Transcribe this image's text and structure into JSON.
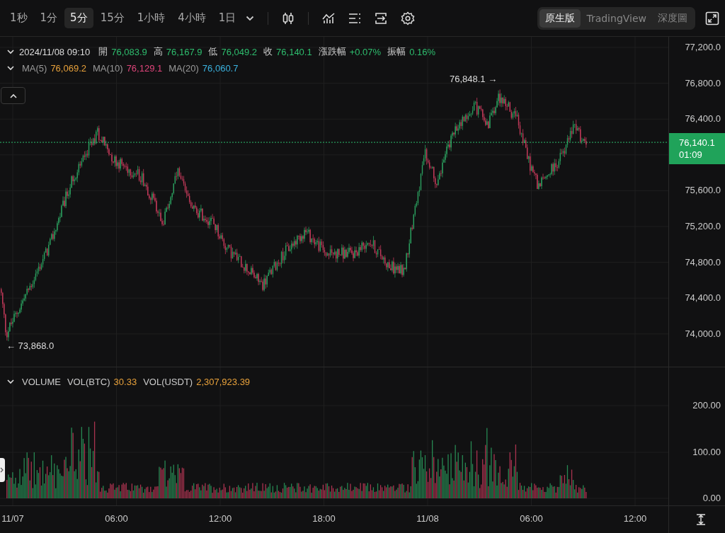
{
  "toolbar": {
    "intervals": [
      {
        "label": "1秒",
        "selected": false
      },
      {
        "label": "1分",
        "selected": false
      },
      {
        "label": "5分",
        "selected": true
      },
      {
        "label": "15分",
        "selected": false
      },
      {
        "label": "1小時",
        "selected": false
      },
      {
        "label": "4小時",
        "selected": false
      },
      {
        "label": "1日",
        "selected": false
      }
    ],
    "view_tabs": [
      {
        "label": "原生版",
        "selected": true
      },
      {
        "label": "TradingView",
        "selected": false
      },
      {
        "label": "深度圖",
        "selected": false
      }
    ]
  },
  "ohlc_legend": {
    "time": "2024/11/08 09:10",
    "fields": [
      {
        "label": "開",
        "value": "76,083.9"
      },
      {
        "label": "高",
        "value": "76,167.9"
      },
      {
        "label": "低",
        "value": "76,049.2"
      },
      {
        "label": "收",
        "value": "76,140.1"
      },
      {
        "label": "漲跌幅",
        "value": "+0.07%"
      },
      {
        "label": "振幅",
        "value": "0.16%"
      }
    ]
  },
  "ma_legend": [
    {
      "label": "MA(5)",
      "value": "76,069.2",
      "color": "#e9a23b"
    },
    {
      "label": "MA(10)",
      "value": "76,129.1",
      "color": "#e0457b"
    },
    {
      "label": "MA(20)",
      "value": "76,060.7",
      "color": "#3bb3e0"
    }
  ],
  "high_marker": "76,848.1 →",
  "low_marker": "← 73,868.0",
  "price_axis": [
    "77,200.0",
    "76,800.0",
    "76,400.0",
    "75,600.0",
    "75,200.0",
    "74,800.0",
    "74,400.0",
    "74,000.0"
  ],
  "last_price": {
    "price": "76,140.1",
    "countdown": "01:09"
  },
  "volume_legend": {
    "title": "VOLUME",
    "fields": [
      {
        "label": "VOL(BTC)",
        "value": "30.33"
      },
      {
        "label": "VOL(USDT)",
        "value": "2,307,923.39"
      }
    ]
  },
  "volume_axis": [
    "200.00",
    "100.00",
    "0.00"
  ],
  "time_axis": [
    "11/07",
    "06:00",
    "12:00",
    "18:00",
    "11/08",
    "06:00",
    "12:00"
  ]
}
